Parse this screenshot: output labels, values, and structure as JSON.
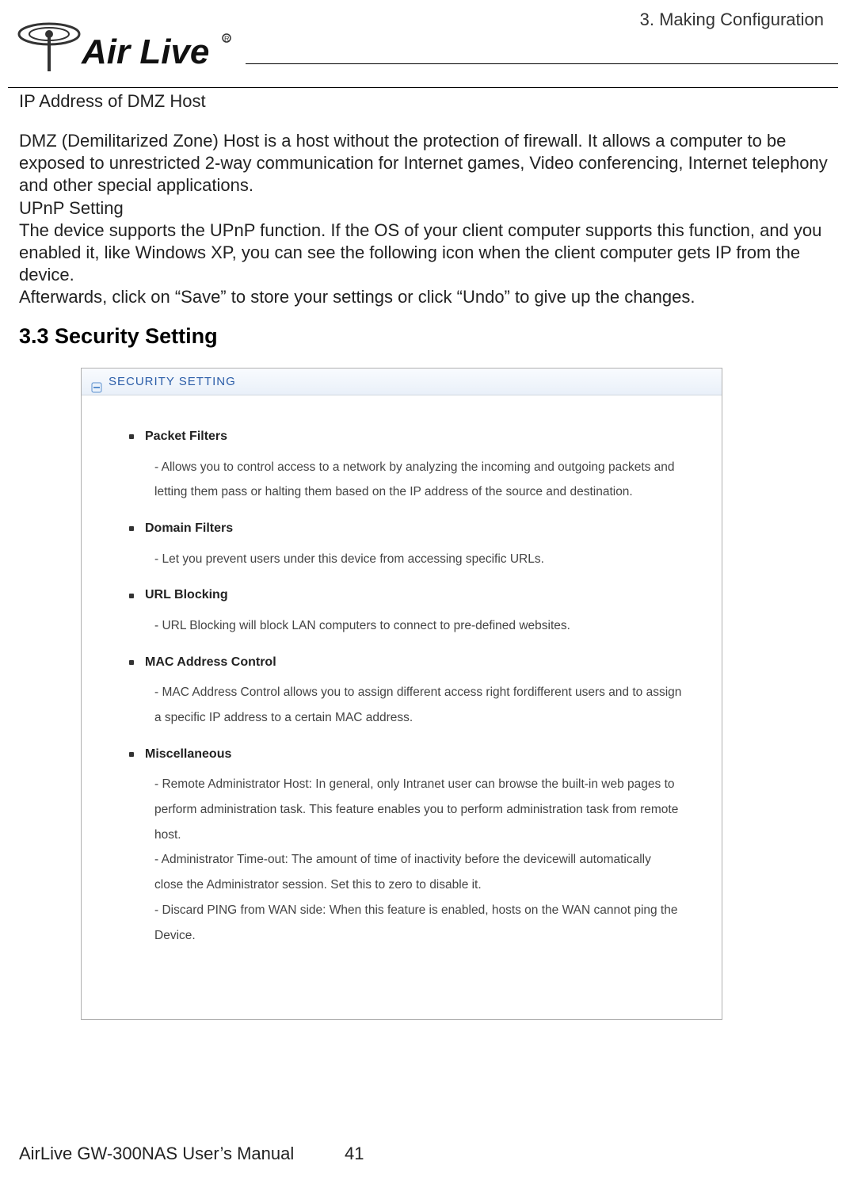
{
  "header": {
    "chapter": "3.  Making  Configuration",
    "brand": "Air Live"
  },
  "content": {
    "h1": "IP Address of DMZ Host",
    "p1": "DMZ (Demilitarized Zone) Host is a host without the protection of firewall. It allows a computer to be exposed to unrestricted 2-way communication for Internet games, Video conferencing, Internet telephony and other special applications.",
    "h2": "UPnP Setting",
    "p2": "The device supports the UPnP function. If the OS of your client computer supports this function, and you enabled it, like Windows XP, you can see the following icon when the client computer gets IP from the device.",
    "p3": "Afterwards, click on “Save” to store your settings or click “Undo” to give up the changes.",
    "section_heading": "3.3 Security Setting"
  },
  "panel": {
    "title": "SECURITY SETTING",
    "features": [
      {
        "title": "Packet Filters",
        "desc": "- Allows you to control access to a network by analyzing the incoming and outgoing packets and letting them pass or halting them based on the IP address of the source and destination."
      },
      {
        "title": "Domain Filters",
        "desc": "- Let you prevent users under this device from accessing specific URLs."
      },
      {
        "title": "URL Blocking",
        "desc": "- URL Blocking will block LAN computers to connect to pre-defined websites."
      },
      {
        "title": "MAC Address Control",
        "desc": "- MAC Address Control allows you to assign different access right fordifferent users and to assign a specific IP address to a certain MAC address."
      },
      {
        "title": "Miscellaneous",
        "desc": "- Remote Administrator Host: In general, only Intranet user can browse the built-in web pages to perform administration task. This feature enables you to perform administration task from remote host.\n- Administrator Time-out: The amount of time of inactivity before the devicewill automatically close the Administrator session. Set this to zero to disable it.\n- Discard PING from WAN side: When this feature is enabled, hosts on the WAN cannot ping the Device."
      }
    ]
  },
  "footer": {
    "manual": "AirLive GW-300NAS User’s Manual",
    "page": "41"
  }
}
